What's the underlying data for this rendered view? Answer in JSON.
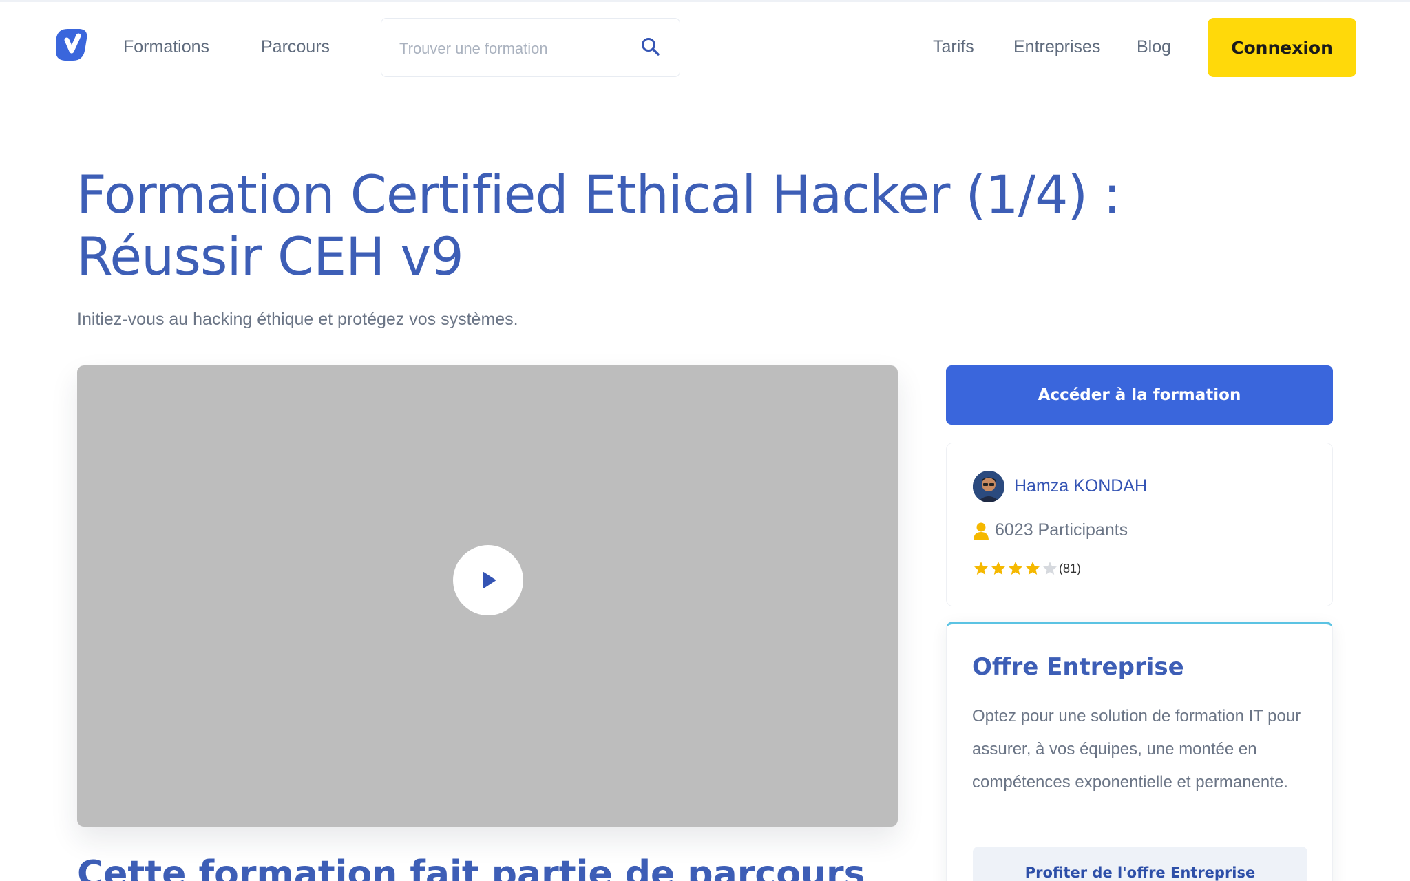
{
  "nav": {
    "logo_icon": "brand-logo-icon",
    "links_left": [
      "Formations",
      "Parcours"
    ],
    "search": {
      "placeholder": "Trouver une formation",
      "icon": "search-icon"
    },
    "links_right": [
      "Tarifs",
      "Entreprises",
      "Blog"
    ],
    "login_label": "Connexion"
  },
  "hero": {
    "title": "Formation Certified Ethical Hacker (1/4) : Réussir CEH v9",
    "subtitle": "Initiez-vous au hacking éthique et protégez vos systèmes."
  },
  "video": {
    "play_icon": "play-icon"
  },
  "section": {
    "heading": "Cette formation fait partie de parcours"
  },
  "sidebar": {
    "access_label": "Accéder à la formation",
    "instructor": "Hamza KONDAH",
    "participants": "6023 Participants",
    "rating": {
      "stars": 4,
      "max": 5,
      "count": "(81)"
    },
    "offer": {
      "title": "Offre Entreprise",
      "text": "Optez pour une solution de formation IT pour assurer, à vos équipes, une montée en compétences exponentielle et permanente.",
      "button_label": "Profiter de l'offre Entreprise"
    }
  },
  "colors": {
    "brand_blue": "#3a66dc",
    "title_blue": "#3d5eb6",
    "cta_yellow": "#ffd90a",
    "star_gold": "#f5b800",
    "offer_accent": "#5bc3e3"
  }
}
